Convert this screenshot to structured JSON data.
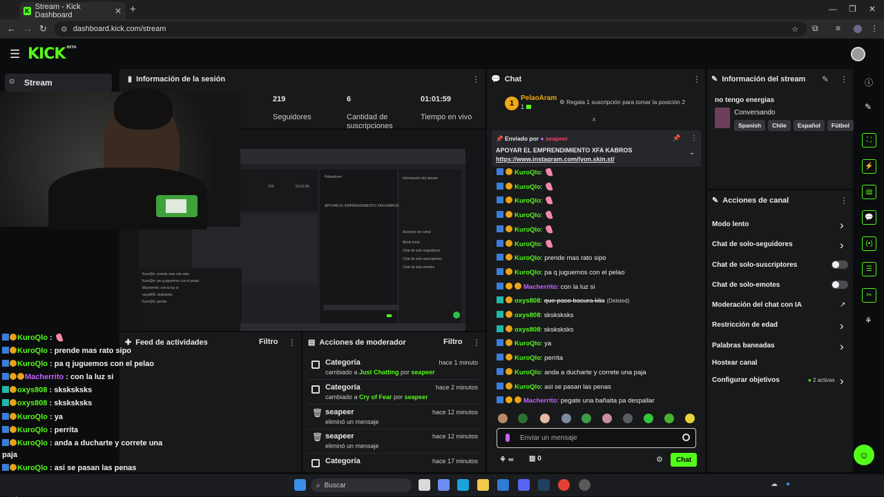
{
  "browser": {
    "tab_title": "Stream - Kick Dashboard",
    "url": "dashboard.kick.com/stream",
    "favicon_letter": "K"
  },
  "header": {
    "logo": "KICK",
    "logo_sup": "BETA"
  },
  "nav": {
    "stream_label": "Stream"
  },
  "session": {
    "title": "Información de la sesión",
    "stats": [
      {
        "value": "219",
        "label": "Seguidores"
      },
      {
        "value": "6",
        "label": "Cantidad de suscripciones"
      },
      {
        "value": "01:01:59",
        "label": "Tiempo en vivo"
      }
    ]
  },
  "activity_feed": {
    "title": "Feed de actividades",
    "filter": "Filtro"
  },
  "mod_actions": {
    "title": "Acciones de moderador",
    "filter": "Filtro",
    "items": [
      {
        "title": "Categoría",
        "pre": "cambiado a ",
        "target": "Just Chatting",
        "mid": " por ",
        "actor": "seapeer",
        "time": "hace 1 minuto",
        "icon": "category-icon"
      },
      {
        "title": "Categoría",
        "pre": "cambiado a ",
        "target": "Cry of Fear",
        "mid": " por ",
        "actor": "seapeer",
        "time": "hace 2 minutos",
        "icon": "category-icon"
      },
      {
        "title": "seapeer",
        "pre": "eliminó un mensaje",
        "target": "",
        "mid": "",
        "actor": "",
        "time": "hace 12 minutos",
        "icon": "trash-icon"
      },
      {
        "title": "seapeer",
        "pre": "eliminó un mensaje",
        "target": "",
        "mid": "",
        "actor": "",
        "time": "hace 12 minutos",
        "icon": "trash-icon"
      },
      {
        "title": "Categoría",
        "pre": "",
        "target": "",
        "mid": "",
        "actor": "",
        "time": "hace 17 minutos",
        "icon": "category-icon"
      }
    ]
  },
  "chat": {
    "title": "Chat",
    "top_gifter": {
      "rank": "1",
      "name": "PelaoAram",
      "count": "1",
      "promo": "Regala 1 suscripción para tomar la posición 2"
    },
    "pinned": {
      "sent_by_label": "Enviado por",
      "sent_by_user": "seapeer",
      "message": "APOYAR EL EMPRENDIMIENTO XFA KABROS",
      "link": "https://www.instagram.com/lyon.skin.st/"
    },
    "messages": [
      {
        "user": "KuroQlo",
        "text": "",
        "emote": true,
        "badges": [
          "mod",
          "sub"
        ],
        "color": "green"
      },
      {
        "user": "KuroQlo",
        "text": "",
        "emote": true,
        "badges": [
          "mod",
          "sub"
        ],
        "color": "green"
      },
      {
        "user": "KuroQlo",
        "text": "",
        "emote": true,
        "badges": [
          "mod",
          "sub"
        ],
        "color": "green"
      },
      {
        "user": "KuroQlo",
        "text": "",
        "emote": true,
        "badges": [
          "mod",
          "sub"
        ],
        "color": "green"
      },
      {
        "user": "KuroQlo",
        "text": "",
        "emote": true,
        "badges": [
          "mod",
          "sub"
        ],
        "color": "green"
      },
      {
        "user": "KuroQlo",
        "text": "",
        "emote": true,
        "badges": [
          "mod",
          "sub"
        ],
        "color": "green"
      },
      {
        "user": "KuroQlo",
        "text": "prende mas rato sipo",
        "badges": [
          "mod",
          "sub"
        ],
        "color": "green"
      },
      {
        "user": "KuroQlo",
        "text": "pa q juguemos con el pelao",
        "badges": [
          "mod",
          "sub"
        ],
        "color": "green"
      },
      {
        "user": "Macherrito",
        "text": "con la luz si",
        "badges": [
          "mod",
          "rank",
          "sub"
        ],
        "color": "purple"
      },
      {
        "user": "oxys808",
        "text": "que paso basura klia",
        "deleted": true,
        "deleted_tag": "(Deleted)",
        "badges": [
          "gift",
          "sub"
        ],
        "color": "green"
      },
      {
        "user": "oxys808",
        "text": "sksksksks",
        "badges": [
          "gift",
          "sub"
        ],
        "color": "green"
      },
      {
        "user": "oxys808",
        "text": "sksksksks",
        "badges": [
          "gift",
          "sub"
        ],
        "color": "green"
      },
      {
        "user": "KuroQlo",
        "text": "ya",
        "badges": [
          "mod",
          "sub"
        ],
        "color": "green"
      },
      {
        "user": "KuroQlo",
        "text": "perrita",
        "badges": [
          "mod",
          "sub"
        ],
        "color": "green"
      },
      {
        "user": "KuroQlo",
        "text": "anda a ducharte y correte una paja",
        "badges": [
          "mod",
          "sub"
        ],
        "color": "green"
      },
      {
        "user": "KuroQlo",
        "text": "asi se pasan las penas",
        "badges": [
          "mod",
          "sub"
        ],
        "color": "green"
      },
      {
        "user": "Macherrito",
        "text": "pegate una bañaita pa despallar",
        "badges": [
          "mod",
          "rank",
          "sub"
        ],
        "color": "purple"
      }
    ],
    "input_placeholder": "Enviar un mensaje",
    "infinity_count": "∞",
    "points": "0",
    "send_label": "Chat"
  },
  "overlay_chat": [
    {
      "user": "KuroQlo",
      "text": " : ",
      "emote": true,
      "color": "green",
      "badges": [
        "mod",
        "sub"
      ]
    },
    {
      "user": "KuroQlo",
      "text": " : prende mas rato sipo",
      "color": "green",
      "badges": [
        "mod",
        "sub"
      ]
    },
    {
      "user": "KuroQlo",
      "text": " : pa q juguemos con el pelao",
      "color": "green",
      "badges": [
        "mod",
        "sub"
      ]
    },
    {
      "user": "Macherrito",
      "text": " : con la luz si",
      "color": "purple",
      "badges": [
        "mod",
        "sub",
        "sub"
      ]
    },
    {
      "user": "oxys808",
      "text": " : sksksksks",
      "color": "green",
      "badges": [
        "gift",
        "sub"
      ]
    },
    {
      "user": "oxys808",
      "text": " : sksksksks",
      "color": "green",
      "badges": [
        "gift",
        "sub"
      ]
    },
    {
      "user": "KuroQlo",
      "text": " : ya",
      "color": "green",
      "badges": [
        "mod",
        "sub"
      ]
    },
    {
      "user": "KuroQlo",
      "text": " : perrita",
      "color": "green",
      "badges": [
        "mod",
        "sub"
      ]
    },
    {
      "user": "KuroQlo",
      "text": " : anda a ducharte y correte una",
      "color": "green",
      "badges": [
        "mod",
        "sub"
      ]
    },
    {
      "user": "",
      "text": "paja",
      "color": "green",
      "badges": []
    },
    {
      "user": "KuroQlo",
      "text": " : asi se pasan las penas",
      "color": "green",
      "badges": [
        "mod",
        "sub"
      ]
    },
    {
      "user": "Macherrito",
      "text": " : pegate una bañaita pa",
      "color": "purple",
      "badges": [
        "mod",
        "sub",
        "sub"
      ]
    },
    {
      "user": "",
      "text": "despallar",
      "color": "purple",
      "badges": []
    }
  ],
  "stream_info": {
    "title": "Información del stream",
    "stream_title": "no tengo energias",
    "category": "Conversando",
    "tags": [
      "Spanish",
      "Chile",
      "Español",
      "Fútbol"
    ]
  },
  "channel_actions": {
    "title": "Acciones de canal",
    "items": [
      {
        "label": "Modo lento",
        "control": "chevron"
      },
      {
        "label": "Chat de solo-seguidores",
        "control": "chevron"
      },
      {
        "label": "Chat de solo-suscriptores",
        "control": "toggle"
      },
      {
        "label": "Chat de solo-emotes",
        "control": "toggle"
      },
      {
        "label": "Moderación del chat con IA",
        "control": "external"
      },
      {
        "label": "Restricción de edad",
        "control": "chevron"
      },
      {
        "label": "Palabras baneadas",
        "control": "chevron"
      },
      {
        "label": "Hostear canal",
        "control": "none"
      },
      {
        "label": "Configurar objetivos",
        "control": "chevron",
        "badge": "2 activas"
      }
    ]
  },
  "taskbar": {
    "search_placeholder": "Buscar"
  },
  "colors": {
    "accent": "#53fc18",
    "panel": "#18191a",
    "background": "#0b0c0d",
    "purple": "#c266ff"
  }
}
